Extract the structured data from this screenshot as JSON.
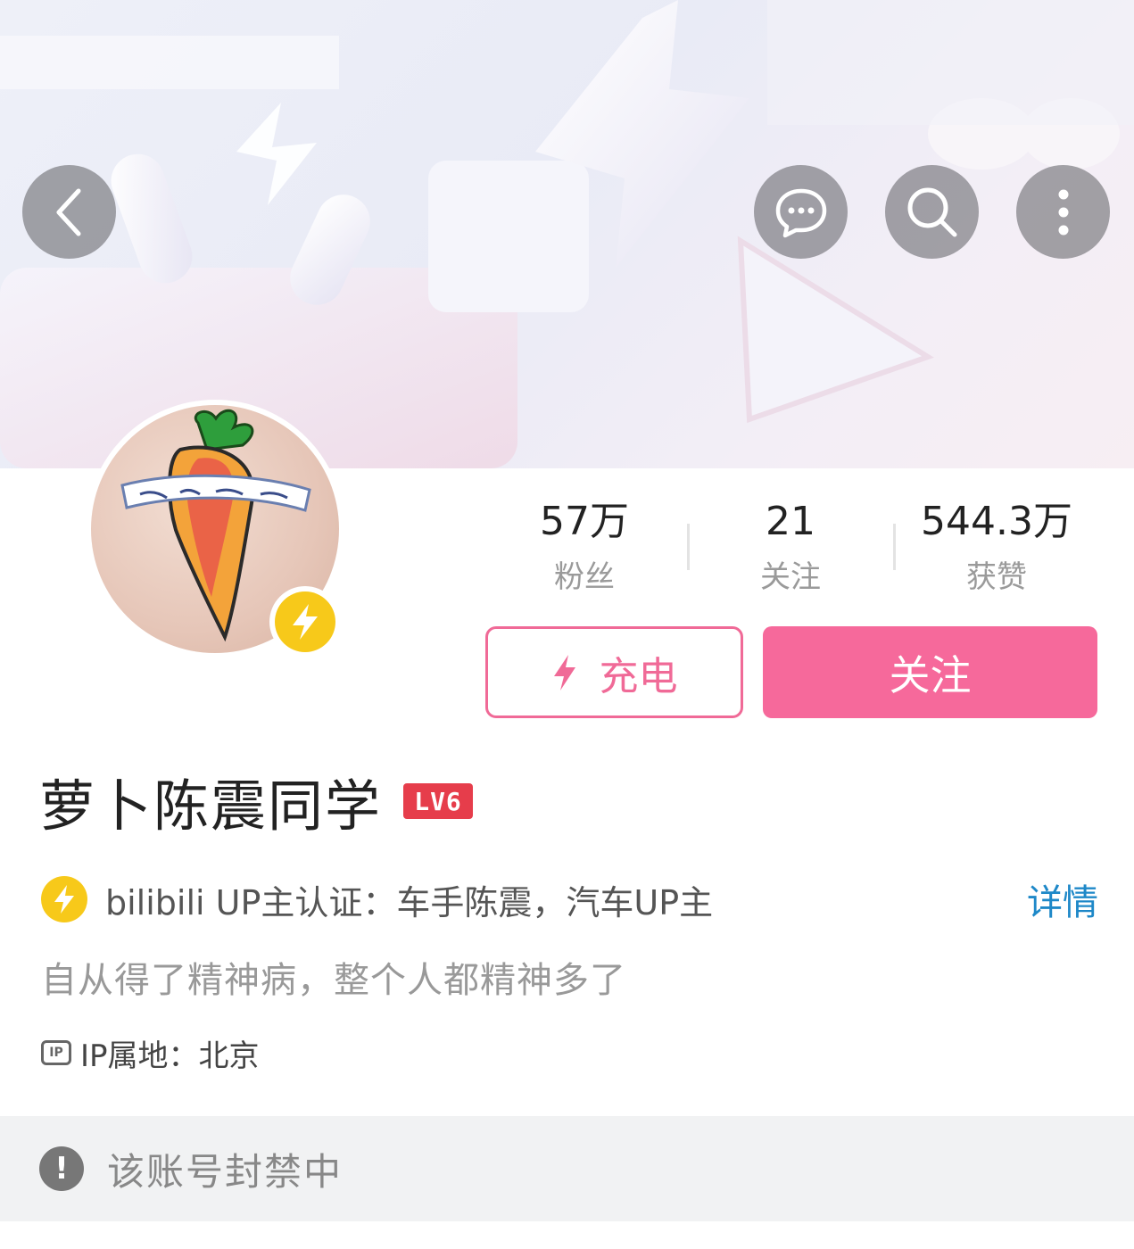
{
  "header": {
    "back_button": "back-arrow-icon",
    "actions": [
      "chat-icon",
      "search-icon",
      "more-icon"
    ]
  },
  "profile": {
    "stats": [
      {
        "value": "57万",
        "label": "粉丝"
      },
      {
        "value": "21",
        "label": "关注"
      },
      {
        "value": "544.3万",
        "label": "获赞"
      }
    ],
    "charge_label": "充电",
    "follow_label": "关注",
    "name": "萝卜陈震同学",
    "level": "LV6",
    "verification": "bilibili UP主认证：车手陈震，汽车UP主",
    "detail_label": "详情",
    "bio": "自从得了精神病，整个人都精神多了",
    "ip_icon_text": "IP",
    "ip_location": "IP属地：北京"
  },
  "notice": {
    "text": "该账号封禁中"
  },
  "colors": {
    "accent_pink": "#f6699b",
    "up_yellow": "#f7c91a",
    "level_red": "#e63d4b",
    "link_blue": "#1e88c8"
  }
}
